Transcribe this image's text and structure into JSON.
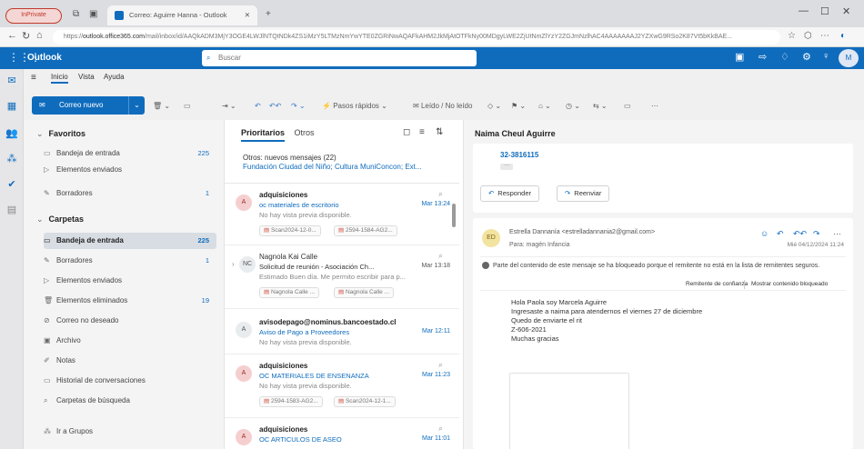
{
  "browser": {
    "inprivate_label": "InPrivate",
    "tab_title": "Correo: Aguirre Hanna - Outlook",
    "url_host": "outlook.office365.com",
    "url_rest": "/mail/inbox/id/AAQkADM3MjY3OGE4LWJlNTQtNDk4ZS1iMzY5LTMzNmYwYTE0ZGRiNwAQAFkAHM2JkMjAtOTFkNy00MDgyLWE2ZjUtNmZlYzY2ZGJmNzlhAC4AAAAAAAJ2YZXwG9RSo2K87Vt5bKkBAE..."
  },
  "outlook": {
    "brand": "Outlook",
    "search_placeholder": "Buscar",
    "user_initials": "M"
  },
  "menu": {
    "tabs": [
      "Inicio",
      "Vista",
      "Ayuda"
    ]
  },
  "toolbar": {
    "new_mail": "Correo nuevo",
    "quick_steps": "Pasos rápidos",
    "read_unread": "Leído / No leído"
  },
  "folders": {
    "favorites_title": "Favoritos",
    "favorites": [
      {
        "name": "Bandeja de entrada",
        "count": "225"
      },
      {
        "name": "Elementos enviados",
        "count": ""
      },
      {
        "name": "Borradores",
        "count": "1"
      }
    ],
    "folders_title": "Carpetas",
    "items": [
      {
        "name": "Bandeja de entrada",
        "count": "225"
      },
      {
        "name": "Borradores",
        "count": "1"
      },
      {
        "name": "Elementos enviados",
        "count": ""
      },
      {
        "name": "Elementos eliminados",
        "count": "19"
      },
      {
        "name": "Correo no deseado",
        "count": ""
      },
      {
        "name": "Archivo",
        "count": ""
      },
      {
        "name": "Notas",
        "count": ""
      },
      {
        "name": "Historial de conversaciones",
        "count": ""
      },
      {
        "name": "Carpetas de búsqueda",
        "count": ""
      }
    ],
    "groups_link": "Ir a Grupos"
  },
  "list": {
    "tab_focused": "Prioritarios",
    "tab_other": "Otros",
    "other_title": "Otros: nuevos mensajes (22)",
    "other_senders": "Fundación Ciudad del Niño; Cultura MuniConcon; Ext...",
    "messages": [
      {
        "initials": "A",
        "from": "adquisiciones",
        "subject": "oc materiales de escritorio",
        "date": "Mar 13:24",
        "preview": "No hay vista previa disponible.",
        "chips": [
          "Scan2024-12-0...",
          "2594-1584-AG2..."
        ]
      },
      {
        "initials": "NC",
        "from": "Nagnola Kai Calle",
        "subject": "Solicitud de reunión - Asociación Ch...",
        "date": "Mar 13:18",
        "preview": "Estimado Buen día. Me permito escribir para p...",
        "chips": [
          "Nagnola Calle ...",
          "Nagnola Calle ..."
        ]
      },
      {
        "initials": "A",
        "from": "avisodepago@nominus.bancoestado.cl",
        "subject": "Aviso de Pago a Proveedores",
        "date": "Mar 12:11",
        "preview": "No hay vista previa disponible.",
        "chips": []
      },
      {
        "initials": "A",
        "from": "adquisiciones",
        "subject": "OC MATERIALES DE ENSENANZA",
        "date": "Mar 11:23",
        "preview": "No hay vista previa disponible.",
        "chips": [
          "2594-1583-AG2...",
          "Scan2024-12-1..."
        ]
      },
      {
        "initials": "A",
        "from": "adquisiciones",
        "subject": "OC ARTICULOS DE ASEO",
        "date": "Mar 11:01",
        "preview": "",
        "chips": []
      }
    ]
  },
  "reading": {
    "title": "Naima Cheul Aguirre",
    "prev_number": "32-3816115",
    "reply": "Responder",
    "forward": "Reenviar",
    "sender_initials": "ED",
    "sender": "Estrella Dannanía <estrelladannania2@gmail.com>",
    "to": "Para: magén Infancia",
    "date": "Mié 04/12/2024 11:24",
    "warning": "Parte del contenido de este mensaje se ha bloqueado porque el remitente no está en la lista de remitentes seguros.",
    "trust_btn": "Remitente de confianza",
    "show_blocked": "Mostrar contenido bloqueado",
    "body_lines": [
      "Hola Paola soy Marcela Aguirre",
      "Ingresaste a naima para atendernos el viernes 27 de diciembre",
      "Quedo de enviarte el rit",
      "Z-606-2021",
      "Muchas gracias"
    ]
  }
}
